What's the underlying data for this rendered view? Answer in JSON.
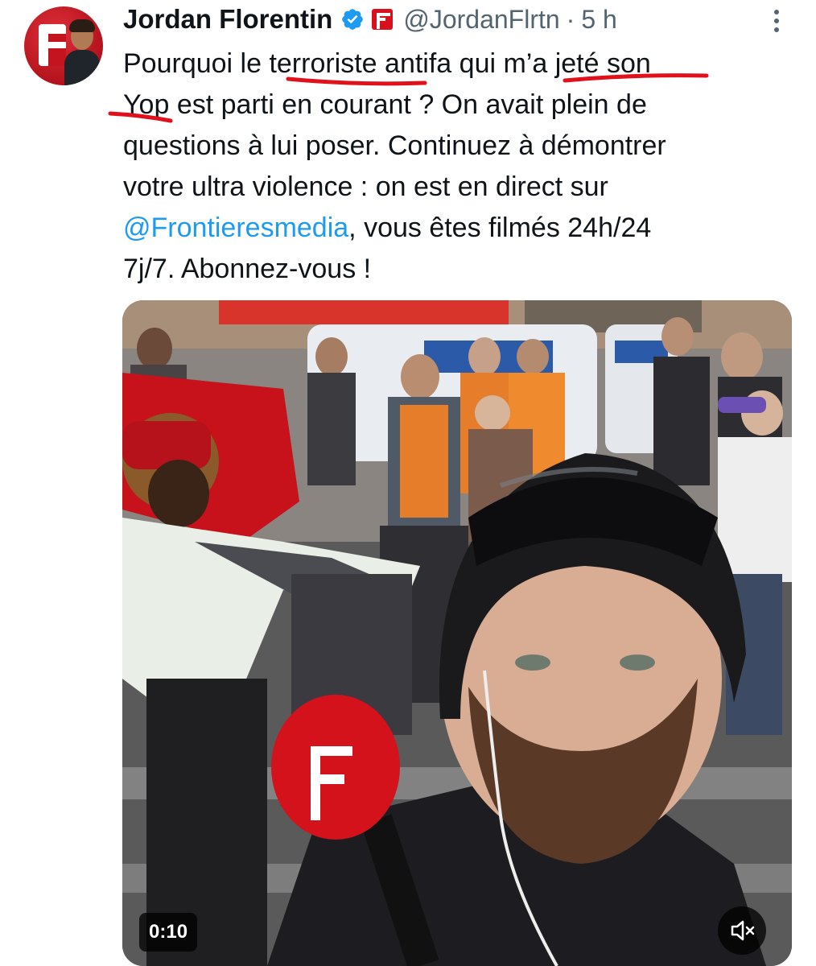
{
  "author": {
    "name": "Jordan Florentin",
    "handle": "@JordanFlrtn",
    "separator": "·",
    "time": "5 h"
  },
  "tweet": {
    "lines": [
      "Pourquoi le terroriste antifa qui m’a jeté son",
      "Yop est parti en courant ? On avait plein de",
      "questions à lui poser. Continuez à démontrer",
      "votre ultra violence : on est en direct sur"
    ],
    "mention": "@Frontieresmedia",
    "line5_rest": ", vous êtes filmés 24h/24",
    "line6": "7j/7. Abonnez-vous !"
  },
  "video": {
    "duration": "0:10"
  },
  "icons": {
    "verified": "verified-badge-icon",
    "affiliate": "frontieres-affiliate-icon",
    "more": "more-options-icon",
    "mute": "volume-muted-icon"
  },
  "colors": {
    "link": "#1d9bf0",
    "verified": "#1d9bf0",
    "underline": "#e0111b",
    "brand_red": "#d8121c",
    "secondary_text": "#536471"
  }
}
